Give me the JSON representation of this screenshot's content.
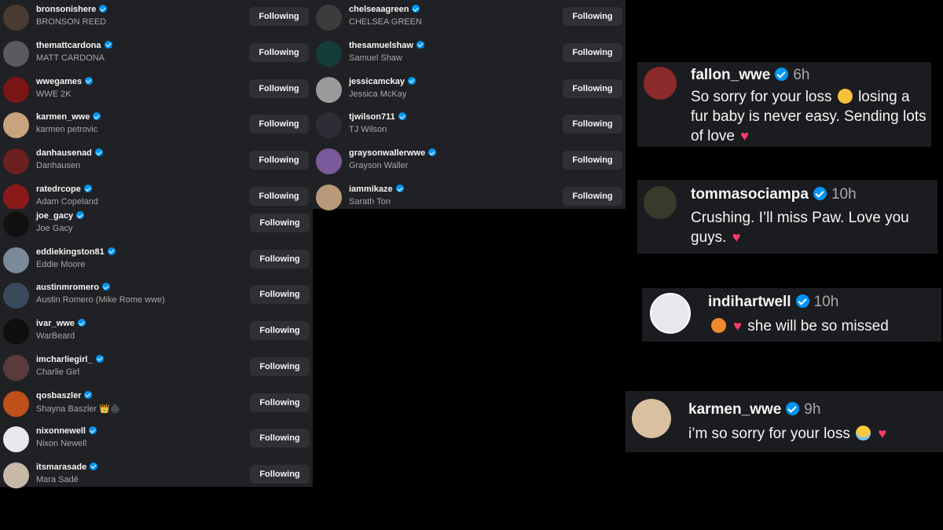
{
  "following_left": [
    {
      "username": "bronsonishere",
      "display": "BRONSON REED",
      "button": "Following",
      "av": "#4a3b32"
    },
    {
      "username": "themattcardona",
      "display": "MATT CARDONA",
      "button": "Following",
      "av": "#5a5a62"
    },
    {
      "username": "wwegames",
      "display": "WWE 2K",
      "button": "Following",
      "av": "#7a1515"
    },
    {
      "username": "karmen_wwe",
      "display": "karmen petrovic",
      "button": "Following",
      "av": "#c8a37e"
    },
    {
      "username": "danhausenad",
      "display": "Danhausen",
      "button": "Following",
      "av": "#6b1f1f"
    },
    {
      "username": "ratedrcope",
      "display": "Adam Copeland",
      "button": "Following",
      "av": "#8a1a1a"
    }
  ],
  "following_middle": [
    {
      "username": "chelseaagreen",
      "display": "CHELSEA GREEN",
      "button": "Following",
      "av": "#3c3c3c"
    },
    {
      "username": "thesamuelshaw",
      "display": "Samuel Shaw",
      "button": "Following",
      "av": "#163b3b"
    },
    {
      "username": "jessicamckay",
      "display": "Jessica McKay",
      "button": "Following",
      "av": "#9a9a9a"
    },
    {
      "username": "tjwilson711",
      "display": "TJ Wilson",
      "button": "Following",
      "av": "#2d2d35"
    },
    {
      "username": "graysonwallerwwe",
      "display": "Grayson Waller",
      "button": "Following",
      "av": "#7a5a9a"
    },
    {
      "username": "iammikaze",
      "display": "Sarath Ton",
      "button": "Following",
      "av": "#b89a7a"
    }
  ],
  "following_bottom": [
    {
      "username": "joe_gacy",
      "display": "Joe Gacy",
      "button": "Following",
      "av": "#111111"
    },
    {
      "username": "eddiekingston81",
      "display": "Eddie Moore",
      "button": "Following",
      "av": "#7a8a9a"
    },
    {
      "username": "austinmromero",
      "display": "Austin Romero (Mike Rome wwe)",
      "button": "Following",
      "av": "#3a4a5a"
    },
    {
      "username": "ivar_wwe",
      "display": "WarBeard",
      "button": "Following",
      "av": "#0f0f0f"
    },
    {
      "username": "imcharliegirl_",
      "display": "Charlie Girl",
      "button": "Following",
      "av": "#5a3b3b"
    },
    {
      "username": "qosbaszler",
      "display": "Shayna Baszler 👑♠️",
      "button": "Following",
      "av": "#c0501a"
    },
    {
      "username": "nixonnewell",
      "display": "Nixon Newell",
      "button": "Following",
      "av": "#e8e8f0"
    },
    {
      "username": "itsmarasade",
      "display": "Mara Sadé",
      "button": "Following",
      "av": "#c8b8a8"
    }
  ],
  "comments": [
    {
      "username": "fallon_wwe",
      "time": "6h",
      "text_a": "So sorry for your loss",
      "text_b": "losing a fur baby is never easy. Sending lots of love",
      "av": "#8a2a2a"
    },
    {
      "username": "tommasociampa",
      "time": "10h",
      "text_a": "Crushing. I’ll miss Paw. Love you guys.",
      "av": "#3a3a2a"
    },
    {
      "username": "indihartwell",
      "time": "10h",
      "text_a": "she will be so missed",
      "av": "#2a2a3a"
    },
    {
      "username": "karmen_wwe",
      "time": "9h",
      "text_a": "i’m so sorry for your loss",
      "av": "#d8c0a0"
    }
  ]
}
